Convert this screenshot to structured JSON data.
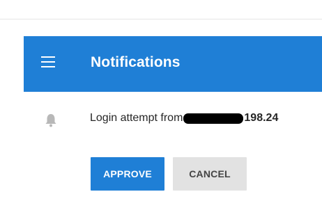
{
  "header": {
    "title": "Notifications",
    "menu_icon": "hamburger-menu-icon"
  },
  "notification": {
    "icon": "bell-icon",
    "message_prefix": "Login attempt from",
    "ip_partial": "198.24"
  },
  "actions": {
    "approve_label": "APPROVE",
    "cancel_label": "CANCEL"
  },
  "colors": {
    "primary": "#1f7fd6",
    "secondary_button": "#e2e2e2"
  }
}
